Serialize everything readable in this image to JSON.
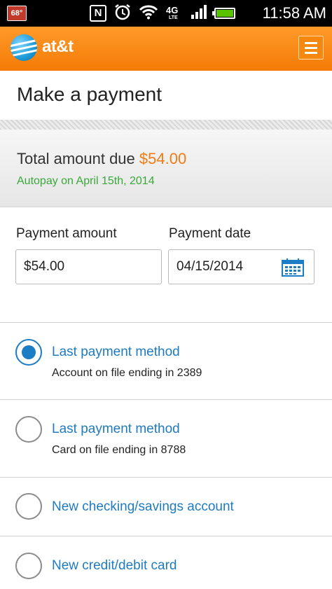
{
  "status_bar": {
    "temperature": "68°",
    "nfc": "N",
    "network": "4G LTE",
    "time": "11:58 AM"
  },
  "app": {
    "brand": "at&t",
    "menu_icon": "hamburger-menu-icon"
  },
  "page": {
    "title": "Make a payment"
  },
  "summary": {
    "total_label": "Total amount due",
    "total_amount": "$54.00",
    "autopay": "Autopay on April 15th, 2014"
  },
  "form": {
    "amount_label": "Payment amount",
    "amount_value": "$54.00",
    "date_label": "Payment date",
    "date_value": "04/15/2014"
  },
  "payment_methods": [
    {
      "title": "Last payment method",
      "subtitle": "Account on file ending in 2389",
      "selected": true
    },
    {
      "title": "Last payment method",
      "subtitle": "Card on file ending in 8788",
      "selected": false
    },
    {
      "title": "New checking/savings account",
      "subtitle": "",
      "selected": false
    },
    {
      "title": "New credit/debit card",
      "subtitle": "",
      "selected": false
    }
  ],
  "colors": {
    "brand_orange": "#f47b05",
    "amount_orange": "#f27b14",
    "link_blue": "#1e7bbf",
    "autopay_green": "#3aa83a"
  }
}
